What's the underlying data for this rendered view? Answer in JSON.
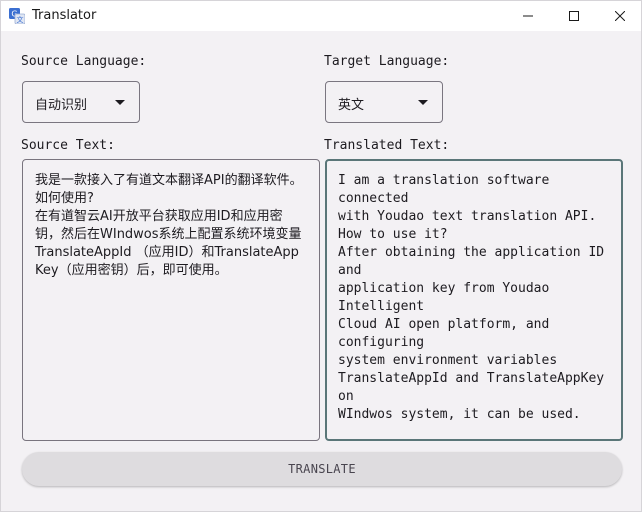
{
  "window": {
    "title": "Translator"
  },
  "source_language": {
    "label": "Source Language:",
    "selected": "自动识别"
  },
  "target_language": {
    "label": "Target Language:",
    "selected": "英文"
  },
  "source_text": {
    "label": "Source Text:",
    "value": "我是一款接入了有道文本翻译API的翻译软件。\n如何使用?\n在有道智云AI开放平台获取应用ID和应用密钥，然后在WIndwos系统上配置系统环境变量TranslateAppId （应用ID）和TranslateAppKey（应用密钥）后，即可使用。"
  },
  "translated_text": {
    "label": "Translated Text:",
    "value": "I am a translation software connected\nwith Youdao text translation API.\nHow to use it?\nAfter obtaining the application ID and\napplication key from Youdao Intelligent\nCloud AI open platform, and configuring\nsystem environment variables\nTranslateAppId and TranslateAppKey on\nWIndwos system, it can be used."
  },
  "actions": {
    "translate_label": "TRANSLATE"
  },
  "icons": {
    "app": "translate-icon",
    "minimize": "minimize-icon",
    "maximize": "maximize-icon",
    "close": "close-icon",
    "dropdown": "chevron-down-icon"
  }
}
